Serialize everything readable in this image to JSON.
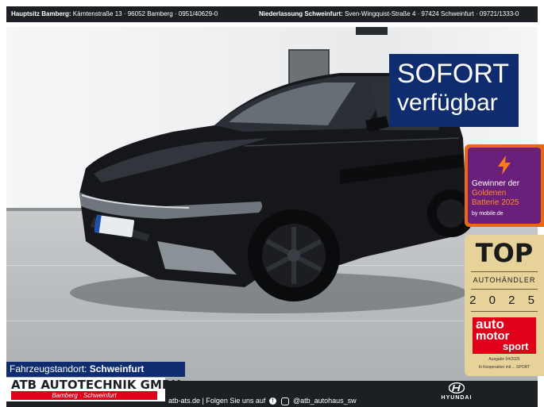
{
  "header": {
    "hq_label": "Hauptsitz Bamberg:",
    "hq_address": "Kärntenstraße 13 · 96052 Bamberg · 0951/40629-0",
    "branch_label": "Niederlassung Schweinfurt:",
    "branch_address": "Sven-Wingquist-Straße 4 · 97424 Schweinfurt · 09721/1333-0"
  },
  "availability": {
    "line1": "SOFORT",
    "line2": "verfügbar"
  },
  "award_battery": {
    "line1": "Gewinner der",
    "line2": "Goldenen",
    "line3": "Batterie 2025",
    "source": "by mobile.de"
  },
  "award_top": {
    "title": "TOP",
    "subtitle": "AUTOHÄNDLER",
    "year": "2 0 2 5",
    "brand_line1": "auto",
    "brand_line2": "motor",
    "brand_line3": "sport",
    "issue": "Ausgabe 04/2025",
    "partner": "In Kooperation mit ... SPORT"
  },
  "location": {
    "label": "Fahrzeugstandort:",
    "value": "Schweinfurt"
  },
  "footer": {
    "company": "ATB AUTOTECHNIK GMBH",
    "company_sub": "Bamberg · Schweinfurt",
    "website": "atb-ats.de",
    "follow": "Folgen Sie uns auf",
    "handle": "@atb_autohaus_sw",
    "dealer_brand": "HYUNDAI"
  },
  "colors": {
    "navy": "#0f2d6e",
    "bar": "#1c1f24",
    "red": "#e1001a",
    "orange": "#e86a10",
    "gold": "#e7d39a"
  }
}
